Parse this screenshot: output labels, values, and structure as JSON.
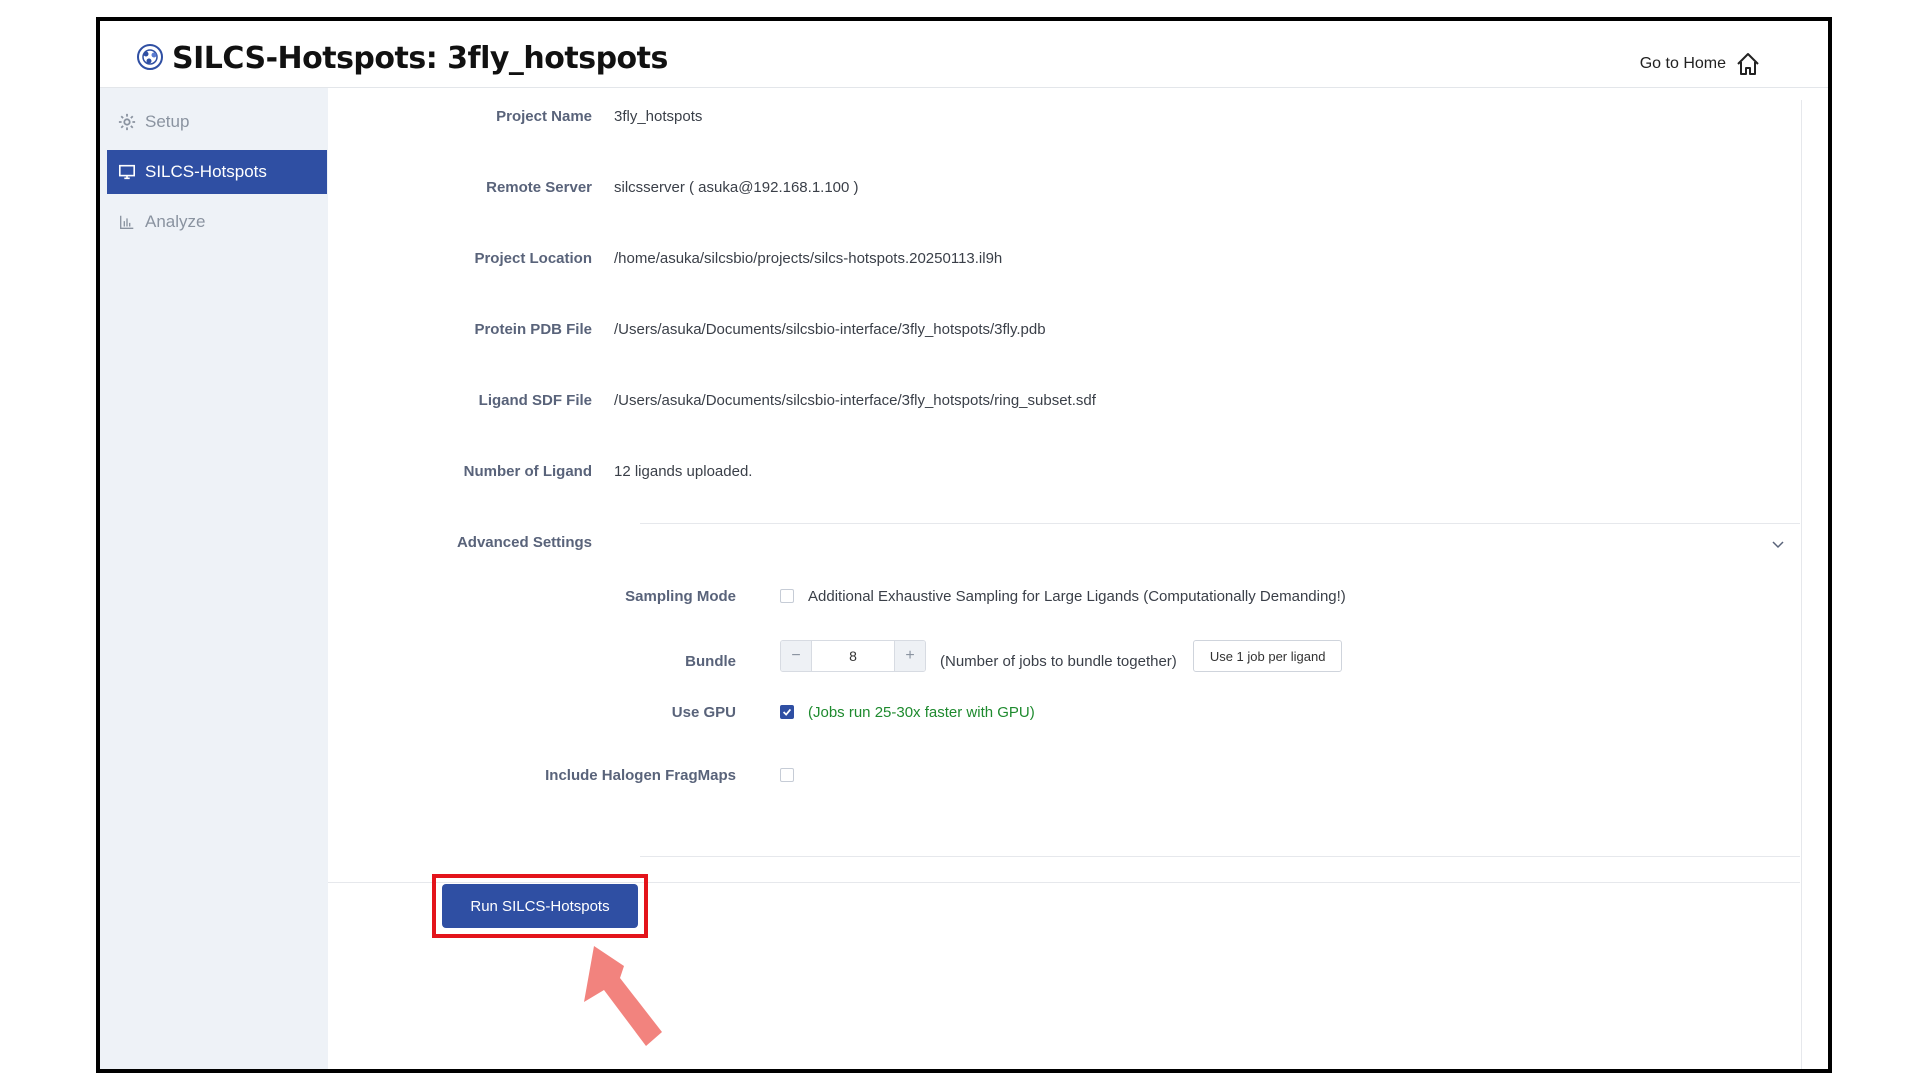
{
  "app": {
    "title": "SILCS-Hotspots: 3fly_hotspots",
    "home_label": "Go to Home"
  },
  "sidebar": {
    "items": [
      {
        "label": "Setup",
        "icon": "gear-icon",
        "active": false
      },
      {
        "label": "SILCS-Hotspots",
        "icon": "monitor-icon",
        "active": true
      },
      {
        "label": "Analyze",
        "icon": "bar-chart-icon",
        "active": false
      }
    ]
  },
  "fields": {
    "project_name": {
      "label": "Project Name",
      "value": "3fly_hotspots"
    },
    "remote_server": {
      "label": "Remote Server",
      "value": "silcsserver ( asuka@192.168.1.100 )"
    },
    "project_location": {
      "label": "Project Location",
      "value": "/home/asuka/silcsbio/projects/silcs-hotspots.20250113.il9h"
    },
    "protein_pdb": {
      "label": "Protein PDB File",
      "value": "/Users/asuka/Documents/silcsbio-interface/3fly_hotspots/3fly.pdb"
    },
    "ligand_sdf": {
      "label": "Ligand SDF File",
      "value": "/Users/asuka/Documents/silcsbio-interface/3fly_hotspots/ring_subset.sdf"
    },
    "num_ligand": {
      "label": "Number of Ligand",
      "value": "12 ligands uploaded."
    }
  },
  "advanced": {
    "label": "Advanced Settings",
    "sampling_mode": {
      "label": "Sampling Mode",
      "option": "Additional Exhaustive Sampling for Large Ligands (Computationally Demanding!)",
      "checked": false
    },
    "bundle": {
      "label": "Bundle",
      "minus": "−",
      "value": "8",
      "plus": "+",
      "hint": "(Number of jobs to bundle together)",
      "button": "Use 1 job per ligand"
    },
    "use_gpu": {
      "label": "Use GPU",
      "hint": "(Jobs run 25-30x faster with GPU)",
      "checked": true
    },
    "halogen": {
      "label": "Include Halogen FragMaps",
      "checked": false
    }
  },
  "actions": {
    "run_label": "Run SILCS-Hotspots"
  },
  "colors": {
    "primary": "#2f4fa3",
    "highlight": "#e3141b",
    "arrow": "#f2837e",
    "sidebar_bg": "#eef2f7",
    "gpu_hint": "#1e8a2e"
  }
}
